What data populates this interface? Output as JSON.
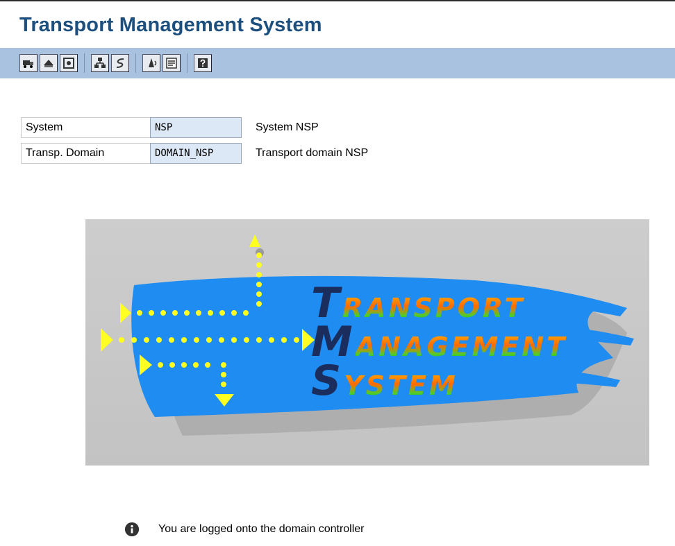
{
  "header": {
    "title": "Transport Management System"
  },
  "toolbar": {
    "buttons": [
      {
        "name": "transport-truck-icon"
      },
      {
        "name": "import-icon"
      },
      {
        "name": "display-icon"
      },
      {
        "name": "hierarchy-icon"
      },
      {
        "name": "routes-icon"
      },
      {
        "name": "alert-icon"
      },
      {
        "name": "overview-icon"
      },
      {
        "name": "help-icon"
      }
    ]
  },
  "fields": [
    {
      "label": "System",
      "value": "NSP",
      "description": "System NSP"
    },
    {
      "label": "Transp. Domain",
      "value": "DOMAIN_NSP",
      "description": "Transport domain NSP"
    }
  ],
  "logo": {
    "line1_cap": "T",
    "line1_rest": "RANSPORT",
    "line2_cap": "M",
    "line2_rest": "ANAGEMENT",
    "line3_cap": "S",
    "line3_rest": "YSTEM",
    "colors": {
      "stroke": "#1e8cf0",
      "arrow": "#ffff22",
      "text_top": "#ff8a00",
      "text_bottom": "#2fae2e"
    }
  },
  "status": {
    "message": "You are logged onto the domain controller",
    "icon": "info-icon"
  }
}
